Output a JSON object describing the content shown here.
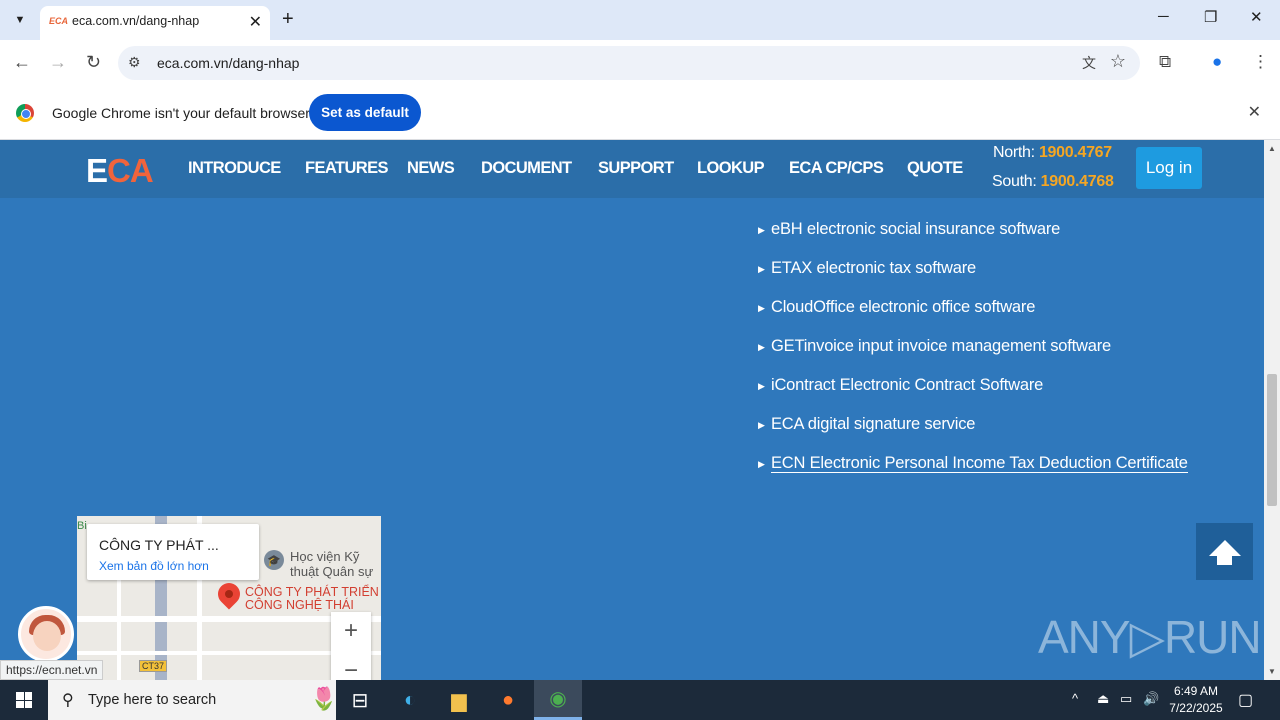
{
  "browser": {
    "tab_title": "eca.com.vn/dang-nhap",
    "tab_favicon_text": "ECA",
    "url": "eca.com.vn/dang-nhap",
    "window_controls": {
      "minimize": "─",
      "restore": "❐",
      "close": "✕"
    }
  },
  "infobar": {
    "message": "Google Chrome isn't your default browser",
    "button": "Set as default"
  },
  "site": {
    "logo_e": "E",
    "logo_ca": "CA",
    "nav": [
      "INTRODUCE",
      "FEATURES",
      "NEWS",
      "DOCUMENT",
      "SUPPORT",
      "LOOKUP",
      "ECA CP/CPS",
      "QUOTE"
    ],
    "hotline_north_label": "North:",
    "hotline_north": "1900.4767",
    "hotline_south_label": "South:",
    "hotline_south": "1900.4768",
    "login": "Log in",
    "products": [
      " eBH electronic social insurance software",
      "ETAX electronic tax software",
      "CloudOffice electronic office software",
      "GETinvoice input invoice management software",
      "iContract Electronic Contract Software",
      "ECA digital signature service",
      "ECN Electronic Personal Income Tax Deduction Certificate"
    ],
    "accent_color": "#f0643c",
    "hotline_color": "#f5a623"
  },
  "map": {
    "card_title": "CÔNG TY PHÁT ...",
    "card_link": "Xem bản đồ lớn hơn",
    "company_line1": "CÔNG TY PHÁT TRIỂN",
    "company_line2": "CÔNG NGHỆ THÁI",
    "school_line1": "Học viện Kỹ",
    "school_line2": "thuật Quân sự",
    "road_shield": "CT37",
    "corner_label": "Bi",
    "zoom_in": "+",
    "zoom_out": "−"
  },
  "status_url": "https://ecn.net.vn",
  "watermark": "ANY▷RUN",
  "taskbar": {
    "search_placeholder": "Type here to search",
    "time": "6:49 AM",
    "date": "7/22/2025"
  }
}
